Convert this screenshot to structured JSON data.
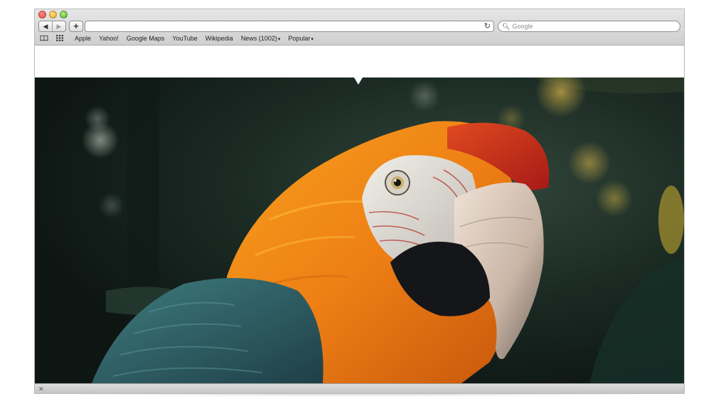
{
  "toolbar": {
    "back_glyph": "◀",
    "forward_glyph": "▶",
    "new_tab_glyph": "+",
    "reload_glyph": "↻",
    "address_value": "",
    "search_placeholder": "Google",
    "search_glyph": "🔍︎"
  },
  "bookmarks": {
    "icons": [
      "reading-list-icon",
      "top-sites-grid-icon"
    ],
    "items": [
      {
        "label": "Apple",
        "has_menu": false
      },
      {
        "label": "Yahoo!",
        "has_menu": false
      },
      {
        "label": "Google Maps",
        "has_menu": false
      },
      {
        "label": "YouTube",
        "has_menu": false
      },
      {
        "label": "Wikipedia",
        "has_menu": false
      },
      {
        "label": "News (1002)",
        "has_menu": true
      },
      {
        "label": "Popular",
        "has_menu": true
      }
    ],
    "menu_caret": "▾"
  },
  "statusbar": {
    "resize_glyph": "✕"
  },
  "colors": {
    "toolbar_top": "#e6e6e6",
    "toolbar_bottom": "#cfcfcf",
    "photo_background": "#17241f",
    "parrot_orange": "#ee7f14",
    "parrot_red": "#b8221a",
    "parrot_teal": "#2c5f66"
  },
  "image": {
    "subject_icon": "macaw-photo"
  }
}
